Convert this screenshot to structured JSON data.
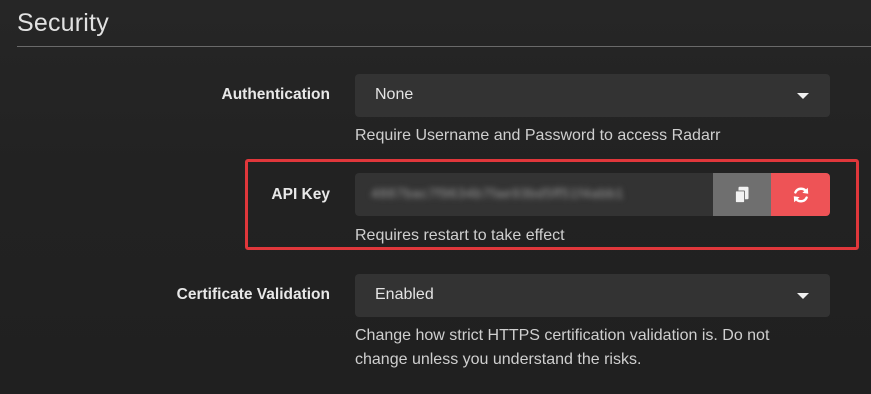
{
  "section": {
    "title": "Security"
  },
  "authentication": {
    "label": "Authentication",
    "value": "None",
    "help": "Require Username and Password to access Radarr"
  },
  "api_key": {
    "label": "API Key",
    "value": "4887bac7f9634b7fae93bd5ff51f4abb1",
    "help": "Requires restart to take effect",
    "copy_icon": "clipboard-copy-icon",
    "regenerate_icon": "refresh-icon"
  },
  "certificate_validation": {
    "label": "Certificate Validation",
    "value": "Enabled",
    "help_line1": "Change how strict HTTPS certification validation is. Do not",
    "help_line2": "change unless you understand the risks."
  },
  "colors": {
    "highlight": "#e0373b",
    "danger_button": "#ee5356",
    "copy_button": "#6f6f6f",
    "input_bg": "#333333"
  }
}
